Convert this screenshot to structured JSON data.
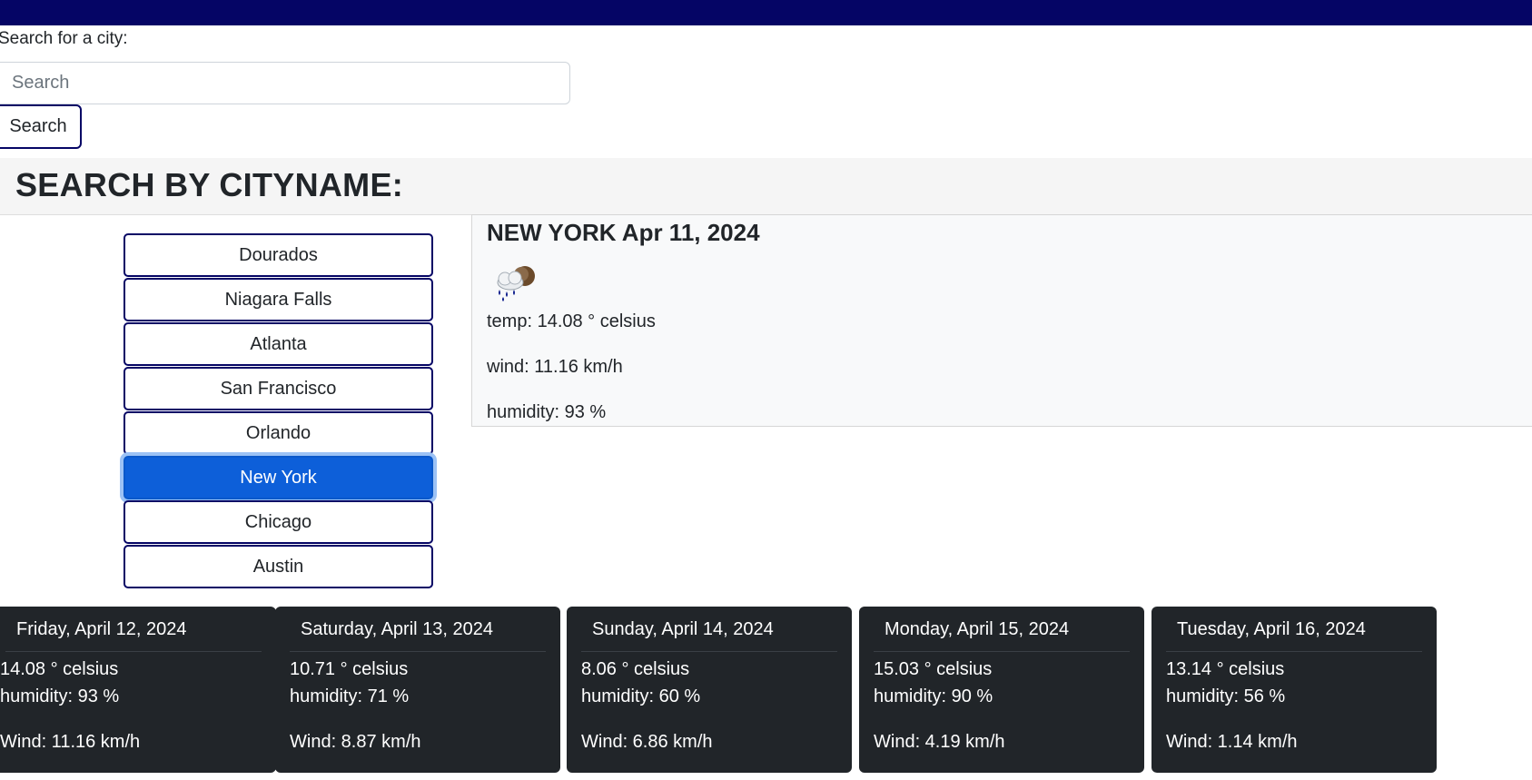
{
  "search": {
    "label": "Search for a city:",
    "placeholder": "Search",
    "value": "",
    "button_label": "Search"
  },
  "header": {
    "title": "SEARCH BY CITYNAME:"
  },
  "colors": {
    "topbar": "#050565",
    "active": "#0d5fd9",
    "card_dark": "#212529"
  },
  "cities": [
    {
      "label": "Dourados"
    },
    {
      "label": "Niagara Falls"
    },
    {
      "label": "Atlanta"
    },
    {
      "label": "San Francisco"
    },
    {
      "label": "Orlando"
    },
    {
      "label": "New York",
      "active": true
    },
    {
      "label": "Chicago"
    },
    {
      "label": "Austin"
    }
  ],
  "current": {
    "title": "NEW YORK Apr 11, 2024",
    "icon": "rain-cloud-icon",
    "temp": "temp: 14.08 ° celsius",
    "wind": "wind: 11.16 km/h",
    "humidity": "humidity: 93 %"
  },
  "forecast": [
    {
      "date": "Friday, April 12, 2024",
      "temp": "14.08 ° celsius",
      "humidity": "humidity: 93 %",
      "wind": "Wind: 11.16 km/h"
    },
    {
      "date": "Saturday, April 13, 2024",
      "temp": "10.71 ° celsius",
      "humidity": "humidity: 71 %",
      "wind": "Wind: 8.87 km/h"
    },
    {
      "date": "Sunday, April 14, 2024",
      "temp": "8.06 ° celsius",
      "humidity": "humidity: 60 %",
      "wind": "Wind: 6.86 km/h"
    },
    {
      "date": "Monday, April 15, 2024",
      "temp": "15.03 ° celsius",
      "humidity": "humidity: 90 %",
      "wind": "Wind: 4.19 km/h"
    },
    {
      "date": "Tuesday, April 16, 2024",
      "temp": "13.14 ° celsius",
      "humidity": "humidity: 56 %",
      "wind": "Wind: 1.14 km/h"
    }
  ]
}
